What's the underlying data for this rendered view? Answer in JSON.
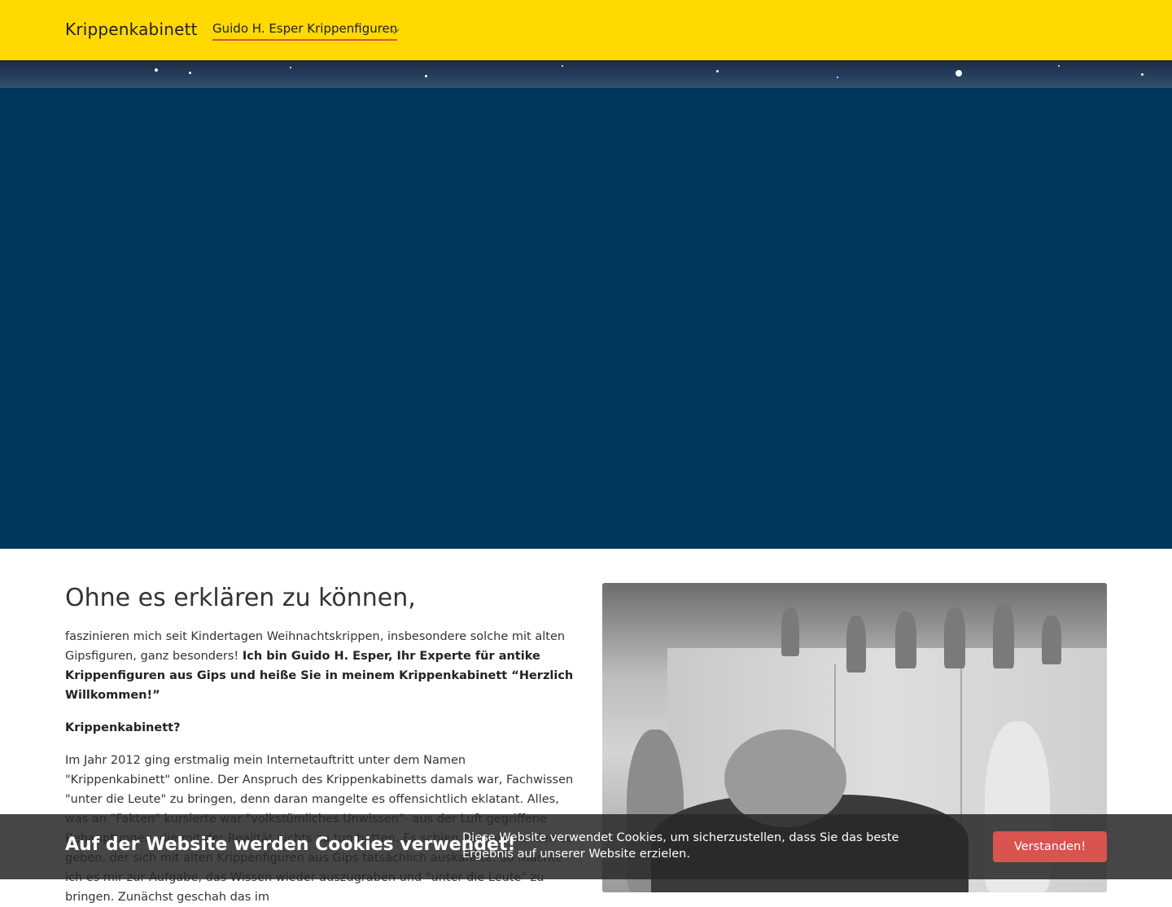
{
  "header": {
    "brand": "Krippenkabinett",
    "nav": [
      {
        "label": "Guido H. Esper Krippenfiguren"
      }
    ]
  },
  "content": {
    "headline": "Ohne es erklären zu können,",
    "intro_text": "faszinieren mich seit Kindertagen Weihnachtskrippen, insbesondere solche mit alten Gipsfiguren, ganz besonders! ",
    "intro_bold": "Ich bin Guido H. Esper, Ihr Experte für antike Krippenfiguren aus Gips und heiße Sie in meinem Krippenkabinett “Herzlich Willkommen!”",
    "subheading": "Krippenkabinett?",
    "body": "Im Jahr 2012 ging erstmalig mein Internetauftritt unter dem Namen \"Krippenkabinett\" online. Der Anspruch des Krippenkabinetts damals war, Fachwissen \"unter die Leute\" zu bringen, denn daran mangelte es offensichtlich eklatant. Alles, was an \"Fakten\" kursierte war \"volkstümliches Unwissen\"- aus der Luft gegriffene Behauptungen, die mit der Realität nichts zu tun hatten. Es schien also niemanden zu geben, der sich mit alten Krippenfiguren aus Gips tatsächlich auskannte. So machte ich es mir zur Aufgabe, das Wissen wieder auszugraben und \"unter die Leute\" zu bringen. Zunächst geschah das im"
  },
  "cookie": {
    "title": "Auf der Website werden Cookies verwendet!",
    "text": "Diese Website verwendet Cookies, um sicherzustellen, dass Sie das beste Ergebnis auf unserer Website erzielen.",
    "button": "Verstanden!"
  },
  "colors": {
    "header_bg": "#ffd900",
    "hero_bg": "#00375d",
    "accent": "#d9534f"
  },
  "icons": {
    "nav_dropdown": "chevron-down-icon"
  }
}
